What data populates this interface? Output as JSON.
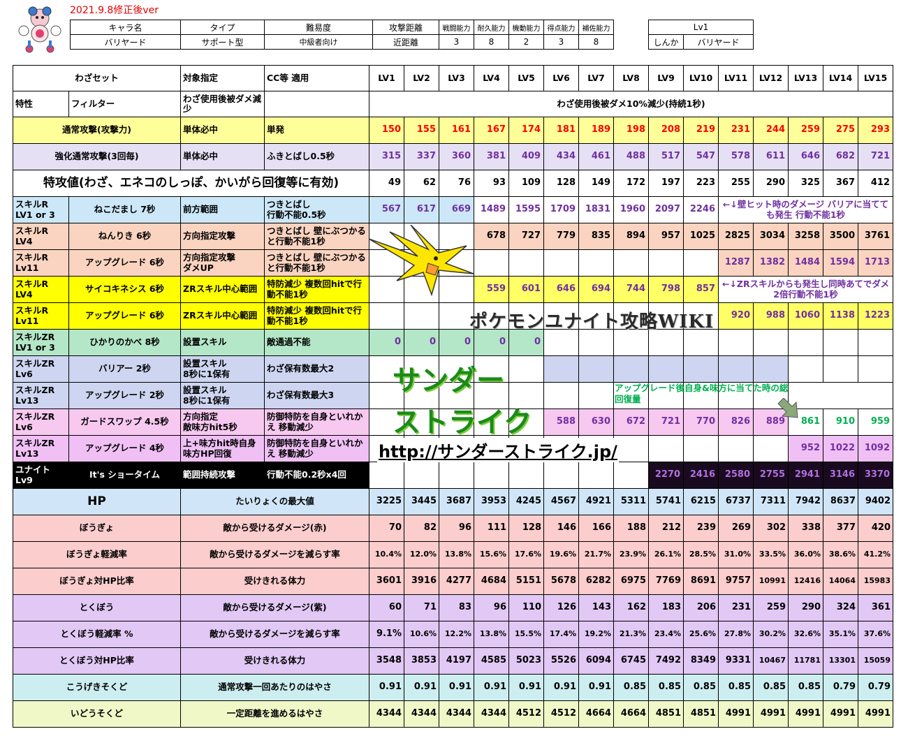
{
  "version_label": "2021.9.8修正後ver",
  "info": {
    "headers": [
      "キャラ名",
      "タイプ",
      "難易度",
      "攻撃距離",
      "戦闘能力",
      "耐久能力",
      "機動能力",
      "得点能力",
      "補佐能力"
    ],
    "values": [
      "バリヤード",
      "サポート型",
      "中級者向け",
      "近距離",
      "3",
      "8",
      "2",
      "3",
      "8"
    ]
  },
  "lv_box": {
    "title": "Lv1",
    "left": "しんか",
    "right": "バリヤード"
  },
  "headers": {
    "set": "わざセット",
    "target": "対象指定",
    "cc": "CC等 適用",
    "levels": [
      "LV1",
      "LV2",
      "LV3",
      "LV4",
      "LV5",
      "LV6",
      "LV7",
      "LV8",
      "LV9",
      "LV10",
      "LV11",
      "LV12",
      "LV13",
      "LV14",
      "LV15"
    ]
  },
  "trait": {
    "label": "特性",
    "name": "フィルター",
    "target": "わざ使用後被ダメ減少",
    "desc": "わざ使用後被ダメ10%減少(持続1秒)"
  },
  "normal_attack": {
    "name": "通常攻撃(攻撃力)",
    "target": "単体必中",
    "cc": "単発",
    "values": [
      "150",
      "155",
      "161",
      "167",
      "174",
      "181",
      "189",
      "198",
      "208",
      "219",
      "231",
      "244",
      "259",
      "275",
      "293"
    ]
  },
  "enhanced_attack": {
    "name": "強化通常攻撃(3回毎)",
    "target": "単体必中",
    "cc": "ふきとばし0.5秒",
    "values": [
      "315",
      "337",
      "360",
      "381",
      "409",
      "434",
      "461",
      "488",
      "517",
      "547",
      "578",
      "611",
      "646",
      "682",
      "721"
    ]
  },
  "sp_attack": {
    "name": "特攻値(わざ、エネコのしっぽ、かいがら回復等に有効)",
    "values": [
      "49",
      "62",
      "76",
      "93",
      "109",
      "128",
      "149",
      "172",
      "197",
      "223",
      "255",
      "290",
      "325",
      "367",
      "412"
    ]
  },
  "skills": [
    {
      "slot": "スキルR\nLV1 or 3",
      "name": "ねこだまし 7秒",
      "target": "前方範囲",
      "cc": "つきとばし\n行動不能0.5秒",
      "values": [
        "567",
        "617",
        "669",
        "1489",
        "1595",
        "1709",
        "1831",
        "1960",
        "2097",
        "2246",
        "",
        "",
        "",
        "",
        ""
      ]
    },
    {
      "slot": "スキルR\nLV4",
      "name": "ねんりき 6秒",
      "target": "方向指定攻撃",
      "cc": "つきとばし 壁にぶつかると行動不能1秒",
      "values": [
        "",
        "",
        "",
        "678",
        "727",
        "779",
        "835",
        "894",
        "957",
        "1025",
        "2825",
        "3034",
        "3258",
        "3500",
        "3761"
      ]
    },
    {
      "slot": "スキルR\nLv11",
      "name": "アップグレード 6秒",
      "target": "方向指定攻撃\nダメUP",
      "cc": "つきとばし 壁にぶつかると行動不能1秒",
      "values": [
        "",
        "",
        "",
        "",
        "",
        "",
        "",
        "",
        "",
        "",
        "1287",
        "1382",
        "1484",
        "1594",
        "1713"
      ]
    },
    {
      "slot": "スキルR\nLV4",
      "name": "サイコキネシス 6秒",
      "target": "ZRスキル中心範囲",
      "cc": "特防減少 複数回hitで行動不能1秒",
      "values": [
        "",
        "",
        "",
        "559",
        "601",
        "646",
        "694",
        "744",
        "798",
        "857",
        "",
        "",
        "",
        "",
        ""
      ]
    },
    {
      "slot": "スキルR\nLv11",
      "name": "アップグレード 6秒",
      "target": "ZRスキル中心範囲",
      "cc": "特防減少 複数回hitで行動不能1秒",
      "values": [
        "",
        "",
        "",
        "",
        "",
        "",
        "",
        "",
        "",
        "",
        "920",
        "988",
        "1060",
        "1138",
        "1223"
      ]
    },
    {
      "slot": "スキルZR\nLV1 or 3",
      "name": "ひかりのかべ 8秒",
      "target": "設置スキル",
      "cc": "敵通過不能",
      "values": [
        "0",
        "0",
        "0",
        "0",
        "0",
        "",
        "",
        "",
        "",
        "",
        "",
        "",
        "",
        "",
        ""
      ]
    },
    {
      "slot": "スキルZR\nLv6",
      "name": "バリアー 2秒",
      "target": "設置スキル\n8秒に1保有",
      "cc": "わざ保有数最大2",
      "values": [
        "",
        "",
        "",
        "",
        "",
        "",
        "",
        "",
        "",
        "",
        "",
        "",
        "",
        "",
        ""
      ]
    },
    {
      "slot": "スキルZR\nLv13",
      "name": "アップグレード 2秒",
      "target": "設置スキル\n8秒に1保有",
      "cc": "わざ保有数最大3",
      "values": [
        "",
        "",
        "",
        "",
        "",
        "",
        "",
        "",
        "",
        "",
        "",
        "",
        "",
        "",
        ""
      ]
    },
    {
      "slot": "スキルZR\nLv6",
      "name": "ガードスワップ 4.5秒",
      "target": "方向指定\n敵味方hit5秒",
      "cc": "防御特防を自身といれかえ 移動減少",
      "values": [
        "",
        "",
        "",
        "",
        "",
        "588",
        "630",
        "672",
        "721",
        "770",
        "826",
        "889",
        "861",
        "910",
        "959"
      ]
    },
    {
      "slot": "スキルZR\nLv13",
      "name": "アップグレード 4秒",
      "target": "上+味方hit時自身味方HP回復",
      "cc": "防御特防を自身といれかえ 移動減少",
      "values": [
        "",
        "",
        "",
        "",
        "",
        "",
        "",
        "",
        "",
        "",
        "",
        "",
        "952",
        "1022",
        "1092"
      ]
    }
  ],
  "notes": {
    "barrier": "←↓壁ヒット時のダメージ バリアに当てても発生 行動不能1秒",
    "zr": "←↓ZRスキルからも発生し同時あてでダメ2倍行動不能1秒",
    "heal": "アップグレード後自身&味方に当てた時の総回復量"
  },
  "unite": {
    "slot": "ユナイト\nLv9",
    "name": "It's ショータイム",
    "target": "範囲持続攻撃",
    "cc": "行動不能0.2秒x4回",
    "values": [
      "",
      "",
      "",
      "",
      "",
      "",
      "",
      "",
      "2270",
      "2416",
      "2580",
      "2755",
      "2941",
      "3146",
      "3370"
    ]
  },
  "stats": [
    {
      "name": "HP",
      "desc": "たいりょくの最大値",
      "values": [
        "3225",
        "3445",
        "3687",
        "3953",
        "4245",
        "4567",
        "4921",
        "5311",
        "5741",
        "6215",
        "6737",
        "7311",
        "7942",
        "8637",
        "9402"
      ]
    },
    {
      "name": "ぼうぎょ",
      "desc": "敵から受けるダメージ(赤)",
      "values": [
        "70",
        "82",
        "96",
        "111",
        "128",
        "146",
        "166",
        "188",
        "212",
        "239",
        "269",
        "302",
        "338",
        "377",
        "420"
      ]
    },
    {
      "name": "ぼうぎょ軽減率",
      "desc": "敵から受けるダメージを減らす率",
      "values": [
        "10.4%",
        "12.0%",
        "13.8%",
        "15.6%",
        "17.6%",
        "19.6%",
        "21.7%",
        "23.9%",
        "26.1%",
        "28.5%",
        "31.0%",
        "33.5%",
        "36.0%",
        "38.6%",
        "41.2%"
      ]
    },
    {
      "name": "ぼうぎょ対HP比率",
      "desc": "受けきれる体力",
      "values": [
        "3601",
        "3916",
        "4277",
        "4684",
        "5151",
        "5678",
        "6282",
        "6975",
        "7769",
        "8691",
        "9757",
        "10991",
        "12416",
        "14064",
        "15983"
      ]
    },
    {
      "name": "とくぼう",
      "desc": "敵から受けるダメージ(紫)",
      "values": [
        "60",
        "71",
        "83",
        "96",
        "110",
        "126",
        "143",
        "162",
        "183",
        "206",
        "231",
        "259",
        "290",
        "324",
        "361"
      ]
    },
    {
      "name": "とくぼう軽減率 %",
      "desc": "敵から受けるダメージを減らす率",
      "values": [
        "9.1%",
        "10.6%",
        "12.2%",
        "13.8%",
        "15.5%",
        "17.4%",
        "19.2%",
        "21.3%",
        "23.4%",
        "25.6%",
        "27.8%",
        "30.2%",
        "32.6%",
        "35.1%",
        "37.6%"
      ]
    },
    {
      "name": "とくぼう対HP比率",
      "desc": "受けきれる体力",
      "values": [
        "3548",
        "3853",
        "4197",
        "4585",
        "5023",
        "5526",
        "6094",
        "6745",
        "7492",
        "8349",
        "9331",
        "10467",
        "11781",
        "13301",
        "15059"
      ]
    },
    {
      "name": "こうげきそくど",
      "desc": "通常攻撃一回あたりのはやさ",
      "values": [
        "0.91",
        "0.91",
        "0.91",
        "0.91",
        "0.91",
        "0.91",
        "0.91",
        "0.85",
        "0.85",
        "0.85",
        "0.85",
        "0.85",
        "0.85",
        "0.79",
        "0.79"
      ]
    },
    {
      "name": "いどうそくど",
      "desc": "一定距離を進めるはやさ",
      "values": [
        "4344",
        "4344",
        "4344",
        "4344",
        "4512",
        "4512",
        "4664",
        "4664",
        "4851",
        "4851",
        "4991",
        "4991",
        "4991",
        "4991",
        "4991"
      ]
    }
  ],
  "overlay": {
    "wiki": "ポケモンユナイト攻略WIKI",
    "title1": "サンダー",
    "title2": "ストライク",
    "url": "http://サンダーストライク.jp/"
  }
}
